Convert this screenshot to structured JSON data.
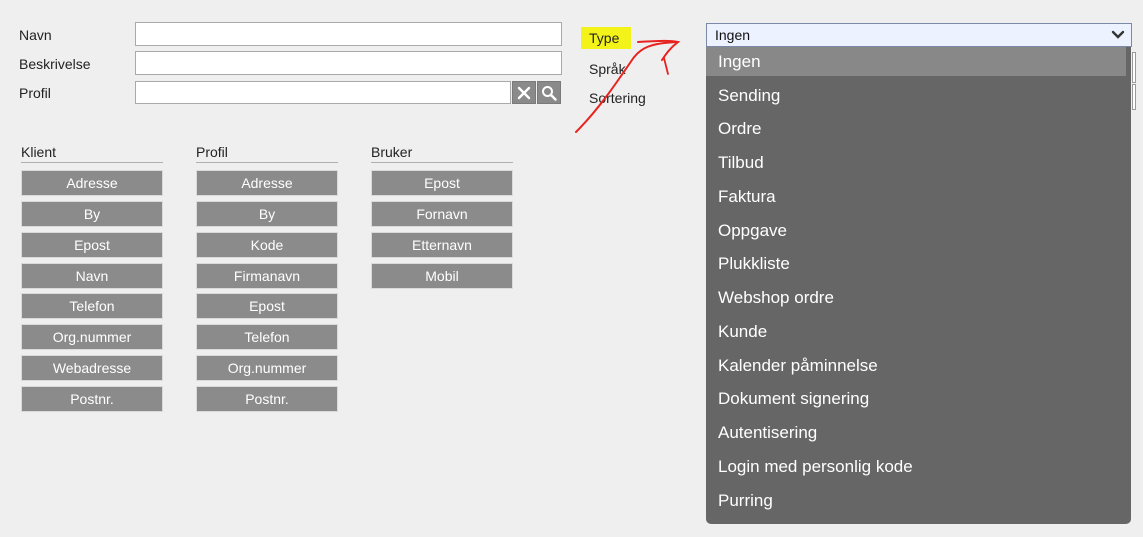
{
  "form": {
    "name_label": "Navn",
    "description_label": "Beskrivelse",
    "profile_label": "Profil",
    "type_label": "Type",
    "language_label": "Språk",
    "sorting_label": "Sortering"
  },
  "columns": [
    {
      "title": "Klient",
      "buttons": [
        "Adresse",
        "By",
        "Epost",
        "Navn",
        "Telefon",
        "Org.nummer",
        "Webadresse",
        "Postnr."
      ]
    },
    {
      "title": "Profil",
      "buttons": [
        "Adresse",
        "By",
        "Kode",
        "Firmanavn",
        "Epost",
        "Telefon",
        "Org.nummer",
        "Postnr."
      ]
    },
    {
      "title": "Bruker",
      "buttons": [
        "Epost",
        "Fornavn",
        "Etternavn",
        "Mobil"
      ]
    }
  ],
  "type_select": {
    "selected": "Ingen",
    "options": [
      "Ingen",
      "Sending",
      "Ordre",
      "Tilbud",
      "Faktura",
      "Oppgave",
      "Plukkliste",
      "Webshop ordre",
      "Kunde",
      "Kalender påminnelse",
      "Dokument signering",
      "Autentisering",
      "Login med personlig kode",
      "Purring"
    ]
  },
  "colors": {
    "annotation_arrow": "#e8221f",
    "highlight": "#f3f31a",
    "button_bg": "#8b8b8b",
    "dropdown_bg": "#666666"
  }
}
